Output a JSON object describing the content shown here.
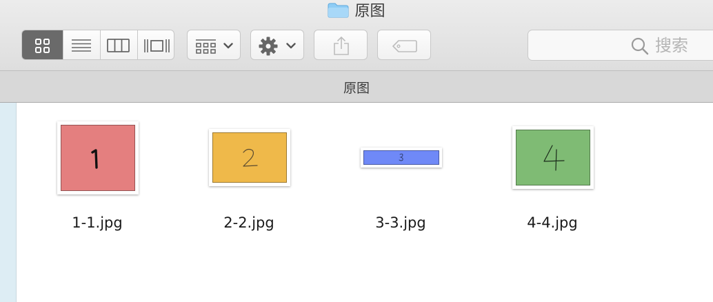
{
  "window": {
    "title": "原图"
  },
  "toolbar": {
    "view_modes": [
      "icon-view",
      "list-view",
      "column-view",
      "cover-flow-view"
    ],
    "active_view": "icon-view",
    "arrange_icon": "grid-arrange-icon",
    "action_icon": "gear-icon",
    "share_icon": "share-icon",
    "tag_icon": "tag-icon",
    "search": {
      "placeholder": "搜索",
      "icon": "search-icon"
    }
  },
  "pathbar": {
    "label": "原图"
  },
  "files": [
    {
      "name": "1-1.jpg",
      "glyph": "1",
      "color": "#e47f7f"
    },
    {
      "name": "2-2.jpg",
      "glyph": "2",
      "color": "#efb94a"
    },
    {
      "name": "3-3.jpg",
      "glyph": "3",
      "color": "#6f89f7"
    },
    {
      "name": "4-4.jpg",
      "glyph": "4",
      "color": "#7fbb74"
    }
  ],
  "colors": {
    "toolbar_bg": "#e4e4e4",
    "active_segment": "#6a6a6a",
    "sidebar_bg": "#ddedf4",
    "folder": "#7cc4f2"
  }
}
